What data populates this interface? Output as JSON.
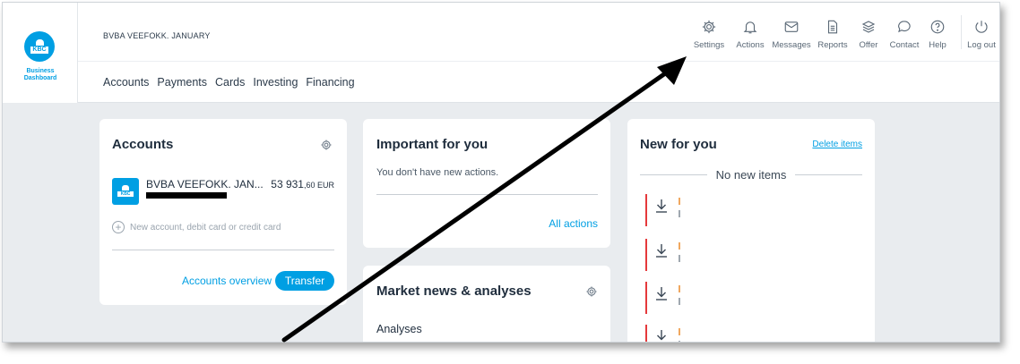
{
  "brand": {
    "logo_text": "KBC",
    "line1": "Business",
    "line2": "Dashboard"
  },
  "header": {
    "company": "BVBA VEEFOKK. JANUARY"
  },
  "toolbar": [
    {
      "label": "Settings",
      "icon": "gear-icon"
    },
    {
      "label": "Actions",
      "icon": "bell-icon"
    },
    {
      "label": "Messages",
      "icon": "envelope-icon"
    },
    {
      "label": "Reports",
      "icon": "document-icon"
    },
    {
      "label": "Offer",
      "icon": "layers-icon"
    },
    {
      "label": "Contact",
      "icon": "chat-bubble-icon"
    },
    {
      "label": "Help",
      "icon": "question-icon"
    },
    {
      "label": "Log out",
      "icon": "power-icon"
    }
  ],
  "nav": [
    "Accounts",
    "Payments",
    "Cards",
    "Investing",
    "Financing"
  ],
  "accounts_card": {
    "title": "Accounts",
    "account_name": "BVBA VEEFOKK. JAN...",
    "amount_int": "53 931",
    "amount_dec": ",60 EUR",
    "icon_text": "KBC",
    "new_account": "New account, debit card or credit card",
    "overview_link": "Accounts overview",
    "transfer_button": "Transfer"
  },
  "important_card": {
    "title": "Important for you",
    "message": "You don't have new actions.",
    "all_actions": "All actions"
  },
  "market_card": {
    "title": "Market news & analyses",
    "analyses": "Analyses"
  },
  "new_card": {
    "title": "New for you",
    "delete_link": "Delete items",
    "no_items": "No new items"
  },
  "colors": {
    "accent": "#009fe3",
    "alert": "#e5393b"
  }
}
